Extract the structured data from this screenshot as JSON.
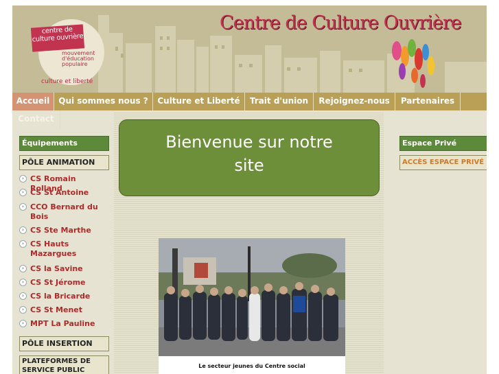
{
  "header": {
    "site_title": "Centre de Culture Ouvrière",
    "logo_line1": "centre de",
    "logo_line2": "culture ouvrière",
    "logo_tag1": "mouvement",
    "logo_tag2": "d'éducation",
    "logo_tag3": "populaire",
    "logo_bottom": "culture et liberté"
  },
  "nav": {
    "items": [
      "Accueil",
      "Qui sommes nous ?",
      "Culture et Liberté",
      "Trait d'union",
      "Rejoignez-nous",
      "Partenaires",
      "Contact"
    ]
  },
  "left": {
    "equipements": "Équipements",
    "pole_animation": "PÔLE ANIMATION",
    "items": [
      "CS Romain Rolland",
      "CS St Antoine",
      "CCO Bernard du Bois",
      "CS Ste Marthe",
      "CS Hauts Mazargues",
      "CS la Savine",
      "CS St Jérome",
      "CS la Bricarde",
      "CS St Menet",
      "MPT La Pauline"
    ],
    "pole_insertion": "PÔLE INSERTION",
    "plateformes": "PLATEFORMES DE SERVICE PUBLIC"
  },
  "center": {
    "welcome_line1": "Bienvenue sur notre",
    "welcome_line2": "site",
    "photo_caption_line1": "Le secteur jeunes du Centre social"
  },
  "right": {
    "espace_prive": "Espace Privé",
    "acces": "ACCÈS ESPACE PRIVÉ"
  },
  "colors": {
    "accent_red": "#c2334f",
    "nav_gold": "#b9a056",
    "green": "#5d8a3a"
  }
}
